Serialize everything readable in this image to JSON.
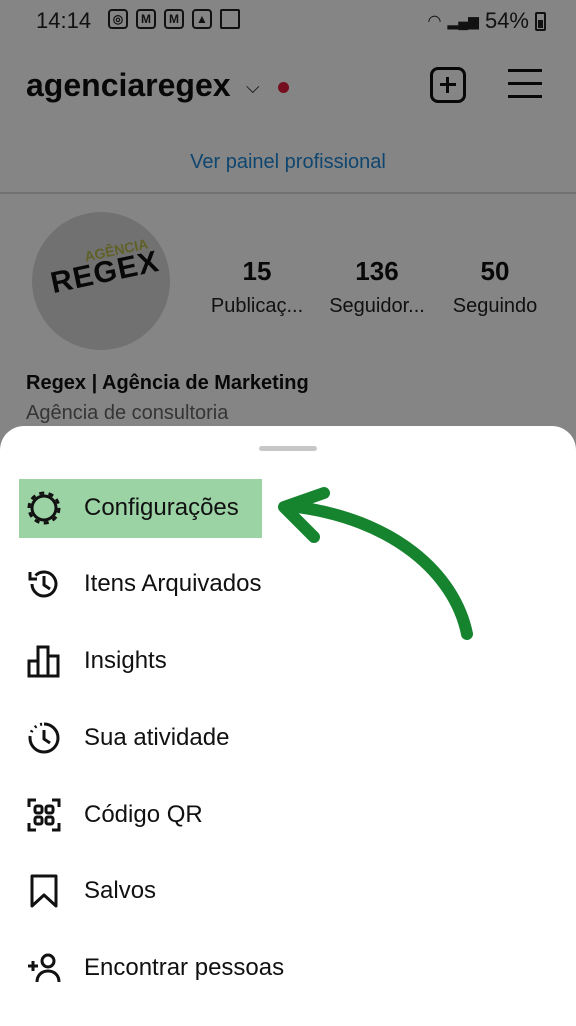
{
  "status_bar": {
    "time": "14:14",
    "battery": "54%"
  },
  "header": {
    "username": "agenciaregex"
  },
  "panel_link": "Ver painel profissional",
  "profile": {
    "stats": [
      {
        "value": "15",
        "label": "Publicaç..."
      },
      {
        "value": "136",
        "label": "Seguidor..."
      },
      {
        "value": "50",
        "label": "Seguindo"
      }
    ],
    "name": "Regex | Agência de Marketing",
    "category": "Agência de consultoria"
  },
  "menu": {
    "items": [
      {
        "label": "Configurações",
        "icon": "settings-gear-icon"
      },
      {
        "label": "Itens Arquivados",
        "icon": "archive-history-icon"
      },
      {
        "label": "Insights",
        "icon": "bar-chart-icon"
      },
      {
        "label": "Sua atividade",
        "icon": "activity-clock-icon"
      },
      {
        "label": "Código QR",
        "icon": "qr-code-icon"
      },
      {
        "label": "Salvos",
        "icon": "bookmark-icon"
      },
      {
        "label": "Encontrar pessoas",
        "icon": "add-person-icon"
      }
    ]
  },
  "colors": {
    "highlight": "#9bd3a4",
    "arrow": "#16832f",
    "link": "#1d86d6",
    "notification_dot": "#e11d3c"
  }
}
